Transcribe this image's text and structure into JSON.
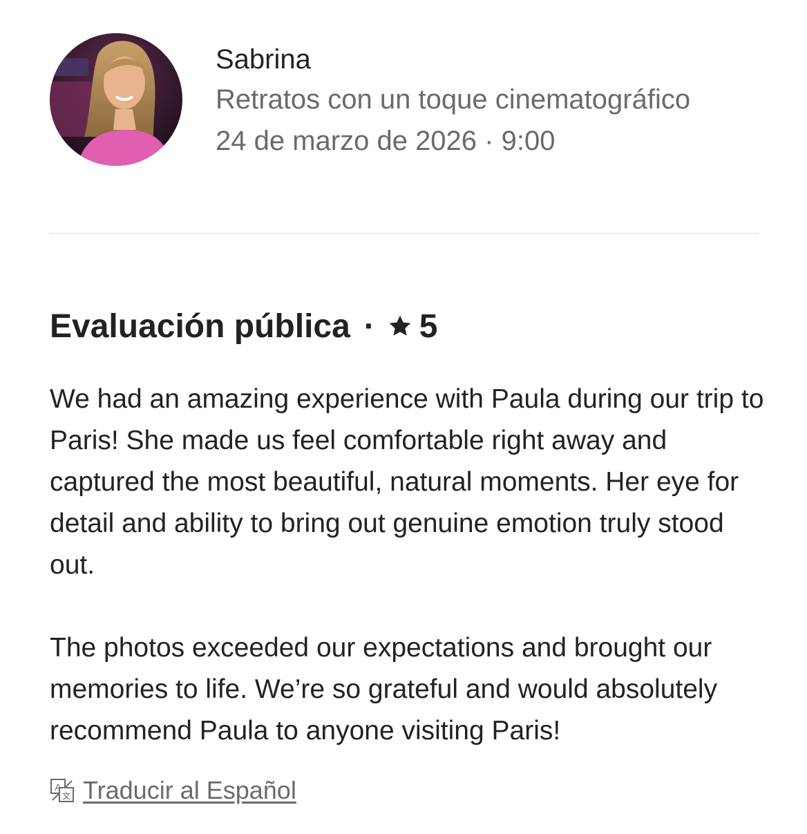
{
  "host": {
    "name": "Sabrina",
    "experience": "Retratos con un toque cinematográfico",
    "date_time": "24 de marzo de 2026 · 9:00",
    "avatar_icon": "profile-photo"
  },
  "review": {
    "title": "Evaluación pública",
    "separator": "·",
    "rating": "5",
    "rating_icon": "star-icon",
    "paragraphs": [
      "We had an amazing experience with Paula during our trip to Paris! She made us feel comfortable right away and captured the most beautiful, natural moments. Her eye for detail and ability to bring out genuine emotion truly stood out.",
      "The photos exceeded our expectations and brought our memories to life. We’re so grateful and would absolutely recommend Paula to anyone visiting Paris!"
    ]
  },
  "translate": {
    "label": "Traducir al Español",
    "icon": "translate-icon"
  }
}
